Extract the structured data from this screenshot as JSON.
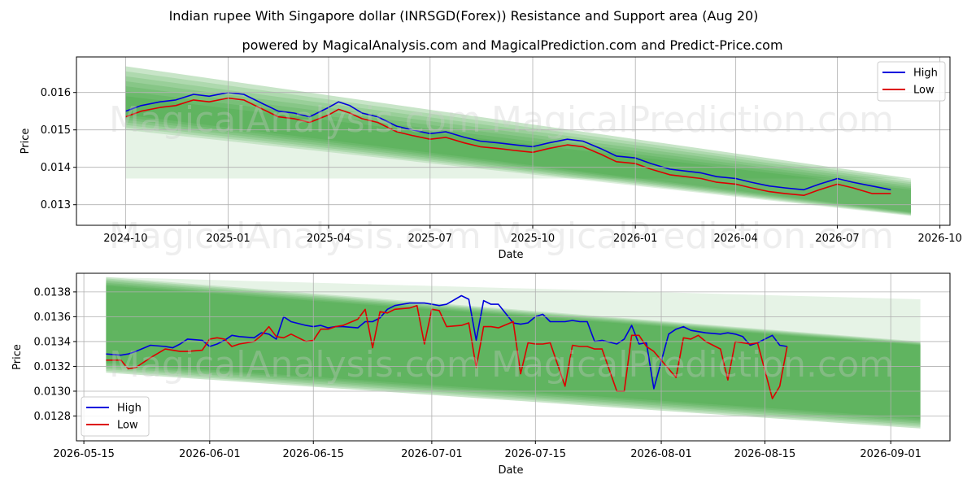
{
  "title": "Indian rupee With Singapore dollar (INRSGD(Forex)) Resistance and Support area (Aug 20)",
  "subtitle": "powered by MagicalAnalysis.com and MagicalPrediction.com and Predict-Price.com",
  "watermarks": [
    "MagicalAnalysis.com",
    "MagicalPrediction.com"
  ],
  "colors": {
    "high": "#0000dd",
    "low": "#dd0000",
    "band": "#2e9a2e",
    "grid": "#b0b0b0"
  },
  "chart_data": [
    {
      "type": "line",
      "xlabel": "Date",
      "ylabel": "Price",
      "x_ticks": [
        "2024-10",
        "2025-01",
        "2025-04",
        "2025-07",
        "2025-10",
        "2026-01",
        "2026-04",
        "2026-07",
        "2026-10"
      ],
      "x_tick_dates": [
        "2024-10-01",
        "2025-01-01",
        "2025-04-01",
        "2025-07-01",
        "2025-10-01",
        "2026-01-01",
        "2026-04-01",
        "2026-07-01",
        "2026-10-01"
      ],
      "y_ticks": [
        "0.013",
        "0.014",
        "0.015",
        "0.016"
      ],
      "xlim": [
        "2024-08-18",
        "2026-10-10"
      ],
      "ylim": [
        0.01245,
        0.01695
      ],
      "grid": true,
      "legend": "top-right",
      "series": [
        {
          "name": "High",
          "x": [
            "2024-10-01",
            "2024-10-15",
            "2024-11-01",
            "2024-11-15",
            "2024-12-01",
            "2024-12-15",
            "2025-01-01",
            "2025-01-15",
            "2025-02-01",
            "2025-02-15",
            "2025-03-01",
            "2025-03-15",
            "2025-04-01",
            "2025-04-10",
            "2025-04-20",
            "2025-05-01",
            "2025-05-15",
            "2025-06-01",
            "2025-06-15",
            "2025-07-01",
            "2025-07-15",
            "2025-08-01",
            "2025-08-15",
            "2025-09-01",
            "2025-09-15",
            "2025-10-01",
            "2025-10-15",
            "2025-11-01",
            "2025-11-15",
            "2025-12-01",
            "2025-12-15",
            "2026-01-01",
            "2026-01-15",
            "2026-02-01",
            "2026-02-15",
            "2026-03-01",
            "2026-03-15",
            "2026-04-01",
            "2026-04-15",
            "2026-05-01",
            "2026-05-15",
            "2026-06-01",
            "2026-06-15",
            "2026-07-01",
            "2026-07-15",
            "2026-08-01",
            "2026-08-18"
          ],
          "values": [
            0.0155,
            0.01565,
            0.01575,
            0.0158,
            0.01595,
            0.0159,
            0.016,
            0.01595,
            0.0157,
            0.0155,
            0.01545,
            0.01535,
            0.0156,
            0.01575,
            0.01565,
            0.01545,
            0.01535,
            0.0151,
            0.015,
            0.0149,
            0.01495,
            0.0148,
            0.0147,
            0.01465,
            0.0146,
            0.01455,
            0.01465,
            0.01475,
            0.0147,
            0.0145,
            0.0143,
            0.01425,
            0.0141,
            0.01395,
            0.0139,
            0.01385,
            0.01375,
            0.0137,
            0.0136,
            0.0135,
            0.01345,
            0.0134,
            0.01355,
            0.0137,
            0.0136,
            0.0135,
            0.0134
          ]
        },
        {
          "name": "Low",
          "x": [
            "2024-10-01",
            "2024-10-15",
            "2024-11-01",
            "2024-11-15",
            "2024-12-01",
            "2024-12-15",
            "2025-01-01",
            "2025-01-15",
            "2025-02-01",
            "2025-02-15",
            "2025-03-01",
            "2025-03-15",
            "2025-04-01",
            "2025-04-10",
            "2025-04-20",
            "2025-05-01",
            "2025-05-15",
            "2025-06-01",
            "2025-06-15",
            "2025-07-01",
            "2025-07-15",
            "2025-08-01",
            "2025-08-15",
            "2025-09-01",
            "2025-09-15",
            "2025-10-01",
            "2025-10-15",
            "2025-11-01",
            "2025-11-15",
            "2025-12-01",
            "2025-12-15",
            "2026-01-01",
            "2026-01-15",
            "2026-02-01",
            "2026-02-15",
            "2026-03-01",
            "2026-03-15",
            "2026-04-01",
            "2026-04-15",
            "2026-05-01",
            "2026-05-15",
            "2026-06-01",
            "2026-06-15",
            "2026-07-01",
            "2026-07-15",
            "2026-08-01",
            "2026-08-18"
          ],
          "values": [
            0.01535,
            0.0155,
            0.0156,
            0.01565,
            0.0158,
            0.01575,
            0.01585,
            0.0158,
            0.01555,
            0.01535,
            0.0153,
            0.0152,
            0.0154,
            0.01555,
            0.01545,
            0.0153,
            0.0152,
            0.01495,
            0.01485,
            0.01475,
            0.0148,
            0.01465,
            0.01455,
            0.0145,
            0.01445,
            0.0144,
            0.0145,
            0.0146,
            0.01455,
            0.01435,
            0.01415,
            0.0141,
            0.01395,
            0.0138,
            0.01375,
            0.0137,
            0.0136,
            0.01355,
            0.01345,
            0.01335,
            0.0133,
            0.01325,
            0.0134,
            0.01355,
            0.01345,
            0.0133,
            0.0133
          ]
        }
      ],
      "support_resistance_band": {
        "x": [
          "2024-10-01",
          "2026-09-05"
        ],
        "upper_start": 0.0167,
        "upper_end": 0.0137,
        "lower_start": 0.015,
        "lower_end": 0.0127,
        "core_upper_start": 0.0159,
        "core_upper_end": 0.0134,
        "core_lower_start": 0.0154,
        "core_lower_end": 0.0128,
        "light_lower": 0.0137
      }
    },
    {
      "type": "line",
      "xlabel": "Date",
      "ylabel": "Price",
      "x_ticks": [
        "2026-05-15",
        "2026-06-01",
        "2026-06-15",
        "2026-07-01",
        "2026-07-15",
        "2026-08-01",
        "2026-08-15",
        "2026-09-01"
      ],
      "y_ticks": [
        "0.0128",
        "0.0130",
        "0.0132",
        "0.0134",
        "0.0136",
        "0.0138"
      ],
      "xlim": [
        "2026-05-14",
        "2026-09-09"
      ],
      "ylim": [
        0.0126,
        0.01395
      ],
      "grid": true,
      "legend": "bottom-left",
      "series": [
        {
          "name": "High",
          "x": [
            "2026-05-18",
            "2026-05-20",
            "2026-05-21",
            "2026-05-22",
            "2026-05-24",
            "2026-05-26",
            "2026-05-27",
            "2026-05-28",
            "2026-05-29",
            "2026-05-31",
            "2026-06-01",
            "2026-06-02",
            "2026-06-03",
            "2026-06-04",
            "2026-06-05",
            "2026-06-07",
            "2026-06-08",
            "2026-06-09",
            "2026-06-10",
            "2026-06-11",
            "2026-06-12",
            "2026-06-14",
            "2026-06-15",
            "2026-06-16",
            "2026-06-17",
            "2026-06-18",
            "2026-06-19",
            "2026-06-21",
            "2026-06-22",
            "2026-06-23",
            "2026-06-24",
            "2026-06-25",
            "2026-06-26",
            "2026-06-28",
            "2026-06-29",
            "2026-06-30",
            "2026-07-01",
            "2026-07-02",
            "2026-07-03",
            "2026-07-05",
            "2026-07-06",
            "2026-07-07",
            "2026-07-08",
            "2026-07-09",
            "2026-07-10",
            "2026-07-12",
            "2026-07-13",
            "2026-07-14",
            "2026-07-15",
            "2026-07-16",
            "2026-07-17",
            "2026-07-19",
            "2026-07-20",
            "2026-07-21",
            "2026-07-22",
            "2026-07-23",
            "2026-07-24",
            "2026-07-26",
            "2026-07-27",
            "2026-07-28",
            "2026-07-29",
            "2026-07-30",
            "2026-07-31",
            "2026-08-02",
            "2026-08-03",
            "2026-08-04",
            "2026-08-05",
            "2026-08-06",
            "2026-08-07",
            "2026-08-09",
            "2026-08-10",
            "2026-08-11",
            "2026-08-12",
            "2026-08-13",
            "2026-08-14",
            "2026-08-16",
            "2026-08-17",
            "2026-08-18"
          ],
          "values": [
            0.0133,
            0.01329,
            0.0133,
            0.01332,
            0.01337,
            0.01336,
            0.01335,
            0.01338,
            0.01342,
            0.01341,
            0.01336,
            0.01338,
            0.01341,
            0.01345,
            0.01344,
            0.01343,
            0.01347,
            0.01346,
            0.01342,
            0.0136,
            0.01356,
            0.01353,
            0.01352,
            0.01353,
            0.01351,
            0.01352,
            0.01352,
            0.01351,
            0.01356,
            0.01356,
            0.01359,
            0.01366,
            0.01369,
            0.01371,
            0.01371,
            0.01371,
            0.0137,
            0.01369,
            0.0137,
            0.01377,
            0.01374,
            0.01341,
            0.01373,
            0.0137,
            0.0137,
            0.01355,
            0.01354,
            0.01355,
            0.0136,
            0.01362,
            0.01356,
            0.01356,
            0.01357,
            0.01356,
            0.01356,
            0.0134,
            0.01341,
            0.01338,
            0.01342,
            0.01353,
            0.01338,
            0.01339,
            0.01302,
            0.01346,
            0.0135,
            0.01352,
            0.01349,
            0.01348,
            0.01347,
            0.01346,
            0.01347,
            0.01346,
            0.01344,
            0.01337,
            0.01339,
            0.01345,
            0.01337,
            0.01336
          ],
          "note": ""
        },
        {
          "name": "Low",
          "x": [
            "2026-05-18",
            "2026-05-20",
            "2026-05-21",
            "2026-05-22",
            "2026-05-24",
            "2026-05-26",
            "2026-05-27",
            "2026-05-28",
            "2026-05-29",
            "2026-05-31",
            "2026-06-01",
            "2026-06-02",
            "2026-06-03",
            "2026-06-04",
            "2026-06-05",
            "2026-06-07",
            "2026-06-08",
            "2026-06-09",
            "2026-06-10",
            "2026-06-11",
            "2026-06-12",
            "2026-06-14",
            "2026-06-15",
            "2026-06-16",
            "2026-06-17",
            "2026-06-18",
            "2026-06-19",
            "2026-06-21",
            "2026-06-22",
            "2026-06-23",
            "2026-06-24",
            "2026-06-25",
            "2026-06-26",
            "2026-06-28",
            "2026-06-29",
            "2026-06-30",
            "2026-07-01",
            "2026-07-02",
            "2026-07-03",
            "2026-07-05",
            "2026-07-06",
            "2026-07-07",
            "2026-07-08",
            "2026-07-09",
            "2026-07-10",
            "2026-07-12",
            "2026-07-13",
            "2026-07-14",
            "2026-07-15",
            "2026-07-16",
            "2026-07-17",
            "2026-07-19",
            "2026-07-20",
            "2026-07-21",
            "2026-07-22",
            "2026-07-23",
            "2026-07-24",
            "2026-07-26",
            "2026-07-27",
            "2026-07-28",
            "2026-07-29",
            "2026-07-30",
            "2026-07-31",
            "2026-08-02",
            "2026-08-03",
            "2026-08-04",
            "2026-08-05",
            "2026-08-06",
            "2026-08-07",
            "2026-08-09",
            "2026-08-10",
            "2026-08-11",
            "2026-08-12",
            "2026-08-13",
            "2026-08-14",
            "2026-08-16",
            "2026-08-17",
            "2026-08-18"
          ],
          "values": [
            0.01325,
            0.01325,
            0.01318,
            0.01319,
            0.01327,
            0.01334,
            0.01333,
            0.01332,
            0.01332,
            0.01333,
            0.01342,
            0.01343,
            0.01342,
            0.01336,
            0.01338,
            0.0134,
            0.01345,
            0.01352,
            0.01344,
            0.01343,
            0.01346,
            0.0134,
            0.01341,
            0.0135,
            0.0135,
            0.01352,
            0.01353,
            0.01358,
            0.01366,
            0.01335,
            0.01364,
            0.01363,
            0.01366,
            0.01367,
            0.01369,
            0.01338,
            0.01366,
            0.01365,
            0.01352,
            0.01353,
            0.01355,
            0.01319,
            0.01352,
            0.01352,
            0.01351,
            0.01356,
            0.01314,
            0.01339,
            0.01338,
            0.01338,
            0.01339,
            0.01304,
            0.01337,
            0.01336,
            0.01336,
            0.01334,
            0.01334,
            0.013,
            0.013,
            0.01345,
            0.01345,
            0.01336,
            0.01332,
            0.01318,
            0.01311,
            0.01343,
            0.01342,
            0.01345,
            0.0134,
            0.01334,
            0.01309,
            0.0134,
            0.01339,
            0.01338,
            0.01339,
            0.01294,
            0.01304,
            0.01336
          ],
          "note": ""
        }
      ],
      "support_resistance_band": {
        "x": [
          "2026-05-18",
          "2026-09-05"
        ],
        "upper_start": 0.01392,
        "upper_end": 0.0134,
        "lower_start": 0.01315,
        "lower_end": 0.0127,
        "core_upper_start": 0.01385,
        "core_upper_end": 0.01337,
        "core_lower_start": 0.01323,
        "core_lower_end": 0.01278,
        "light_upper": 0.01374
      }
    }
  ]
}
